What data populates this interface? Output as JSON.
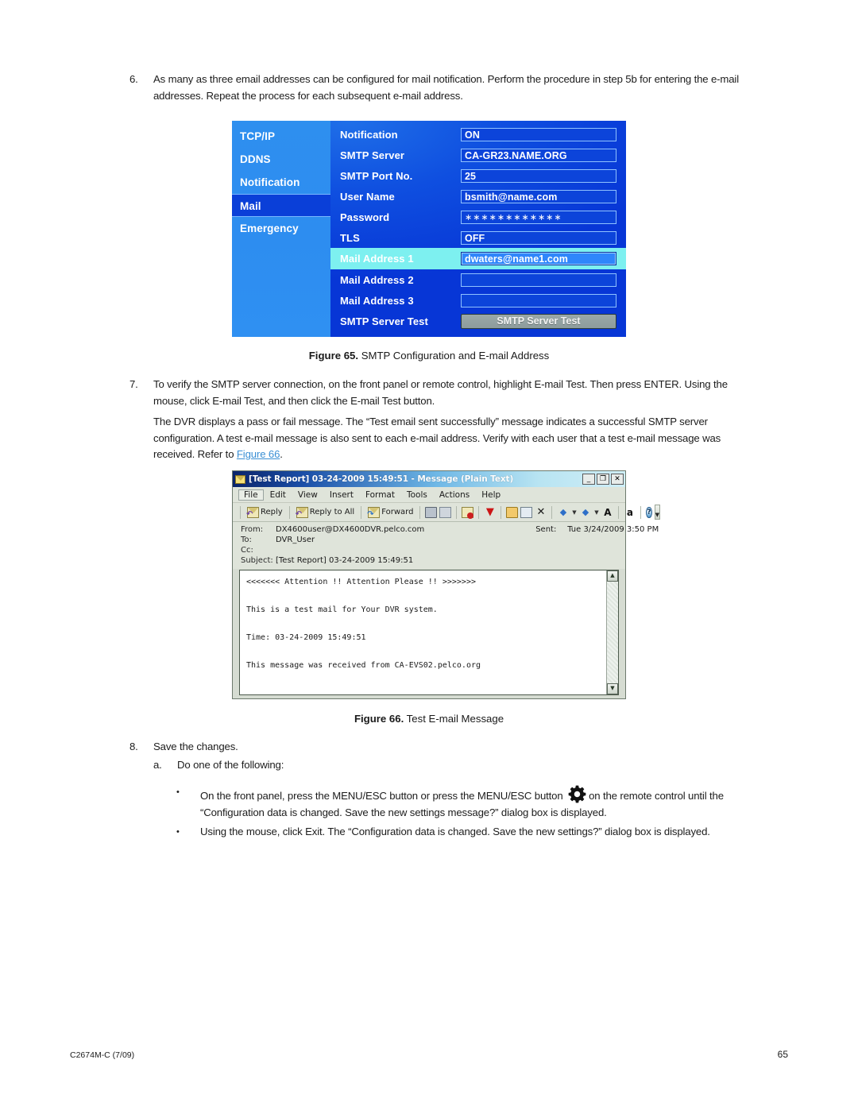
{
  "step6": {
    "marker": "6.",
    "text": "As many as three email addresses can be configured for mail notification. Perform the procedure in step 5b for entering the e-mail addresses. Repeat the process for each subsequent e-mail address."
  },
  "smtp_figure": {
    "sidebar": [
      {
        "label": "TCP/IP",
        "selected": false
      },
      {
        "label": "DDNS",
        "selected": false
      },
      {
        "label": "Notification",
        "selected": false
      },
      {
        "label": "Mail",
        "selected": true
      },
      {
        "label": "Emergency",
        "selected": false
      }
    ],
    "rows": [
      {
        "label": "Notification",
        "value": "ON",
        "type": "field",
        "highlight": false
      },
      {
        "label": "SMTP Server",
        "value": "CA-GR23.NAME.ORG",
        "type": "field",
        "highlight": false
      },
      {
        "label": "SMTP Port No.",
        "value": "25",
        "type": "field",
        "highlight": false
      },
      {
        "label": "User Name",
        "value": "bsmith@name.com",
        "type": "field",
        "highlight": false
      },
      {
        "label": "Password",
        "value": "∗∗∗∗∗∗∗∗∗∗∗∗",
        "type": "password",
        "highlight": false
      },
      {
        "label": "TLS",
        "value": "OFF",
        "type": "field",
        "highlight": false
      },
      {
        "label": "Mail Address 1",
        "value": "dwaters@name1.com",
        "type": "field",
        "highlight": true
      },
      {
        "label": "Mail Address 2",
        "value": "",
        "type": "field",
        "highlight": false
      },
      {
        "label": "Mail Address 3",
        "value": "",
        "type": "field",
        "highlight": false
      },
      {
        "label": "SMTP Server Test",
        "value": "SMTP Server Test",
        "type": "button",
        "highlight": false
      }
    ],
    "colors": {
      "sidebar_blue": "#2e8fef",
      "selected_blue": "#0a3fd8",
      "panel_blue": "#0f4fe0",
      "highlight_cyan": "#7df0f0",
      "button_gray": "#93a1a1"
    }
  },
  "fig65": {
    "number": "Figure 65.",
    "title": "SMTP Configuration and E-mail Address"
  },
  "step7": {
    "marker": "7.",
    "text": "To verify the SMTP server connection, on the front panel or remote control, highlight E-mail Test. Then press ENTER. Using the mouse, click E-mail Test, and then click the E-mail Test button."
  },
  "para_dvr": {
    "text_before": "The DVR displays a pass or fail message. The “Test email sent successfully” message indicates a successful SMTP server configuration. A test e-mail message is also sent to each e-mail address. Verify with each user that a test e-mail message was received. Refer to ",
    "link": "Figure 66",
    "text_after": "."
  },
  "outlook": {
    "title": "[Test Report] 03-24-2009 15:49:51  - Message (Plain Text)",
    "window_buttons": [
      {
        "name": "minimize",
        "glyph": "_"
      },
      {
        "name": "maximize",
        "glyph": "❐"
      },
      {
        "name": "close",
        "glyph": "✕"
      }
    ],
    "menus": [
      "File",
      "Edit",
      "View",
      "Insert",
      "Format",
      "Tools",
      "Actions",
      "Help"
    ],
    "toolbar": [
      {
        "name": "reply",
        "label": "Reply",
        "icon": "reply-icon"
      },
      {
        "name": "reply-all",
        "label": "Reply to All",
        "icon": "reply-all-icon"
      },
      {
        "name": "forward",
        "label": "Forward",
        "icon": "forward-icon"
      },
      {
        "name": "print",
        "label": "",
        "icon": "print-icon"
      },
      {
        "name": "copy",
        "label": "",
        "icon": "copy-icon"
      },
      {
        "name": "delete-mail",
        "label": "",
        "icon": "delete-message-icon"
      },
      {
        "name": "follow-up",
        "label": "",
        "icon": "flag-icon"
      },
      {
        "name": "move-folder",
        "label": "",
        "icon": "folder-icon"
      },
      {
        "name": "move-item",
        "label": "",
        "icon": "move-to-folder-icon"
      },
      {
        "name": "delete",
        "label": "",
        "icon": "delete-x-icon"
      },
      {
        "name": "previous",
        "label": "",
        "icon": "up-arrow-icon"
      },
      {
        "name": "next",
        "label": "",
        "icon": "down-arrow-icon"
      },
      {
        "name": "auto-preview",
        "label": "",
        "icon": "font-size-icon"
      },
      {
        "name": "read-aloud",
        "label": "",
        "icon": "speech-icon"
      },
      {
        "name": "help",
        "label": "",
        "icon": "help-icon"
      }
    ],
    "headers": {
      "from_key": "From:",
      "from_val": "DX4600user@DX4600DVR.pelco.com",
      "sent_key": "Sent:",
      "sent_val": "Tue 3/24/2009 3:50 PM",
      "to_key": "To:",
      "to_val": "DVR_User",
      "cc_key": "Cc:",
      "cc_val": "",
      "subject_key": "Subject:",
      "subject_val": "[Test Report] 03-24-2009 15:49:51"
    },
    "body": "<<<<<<< Attention !! Attention Please !! >>>>>>>\n\nThis is a test mail for Your DVR system.\n\nTime: 03-24-2009 15:49:51\n\nThis message was received from CA-EVS02.pelco.org"
  },
  "fig66": {
    "number": "Figure 66.",
    "title": "Test E-mail Message"
  },
  "step8": {
    "marker": "8.",
    "text": "Save the changes."
  },
  "step8a": {
    "marker": "a.",
    "text": "Do one of the following:"
  },
  "bullets": [
    {
      "marker": "•",
      "text_before": "On the front panel, press the MENU/ESC button or press the MENU/ESC button ",
      "icon": "gear-icon",
      "text_after": "on the remote control until the “Configuration data is changed. Save the new settings message?” dialog box is displayed."
    },
    {
      "marker": "•",
      "text_before": "Using the mouse, click Exit. The “Configuration data is changed. Save the new settings?” dialog box is displayed.",
      "icon": "",
      "text_after": ""
    }
  ],
  "footer": {
    "left": "C2674M-C (7/09)",
    "right": "65"
  }
}
